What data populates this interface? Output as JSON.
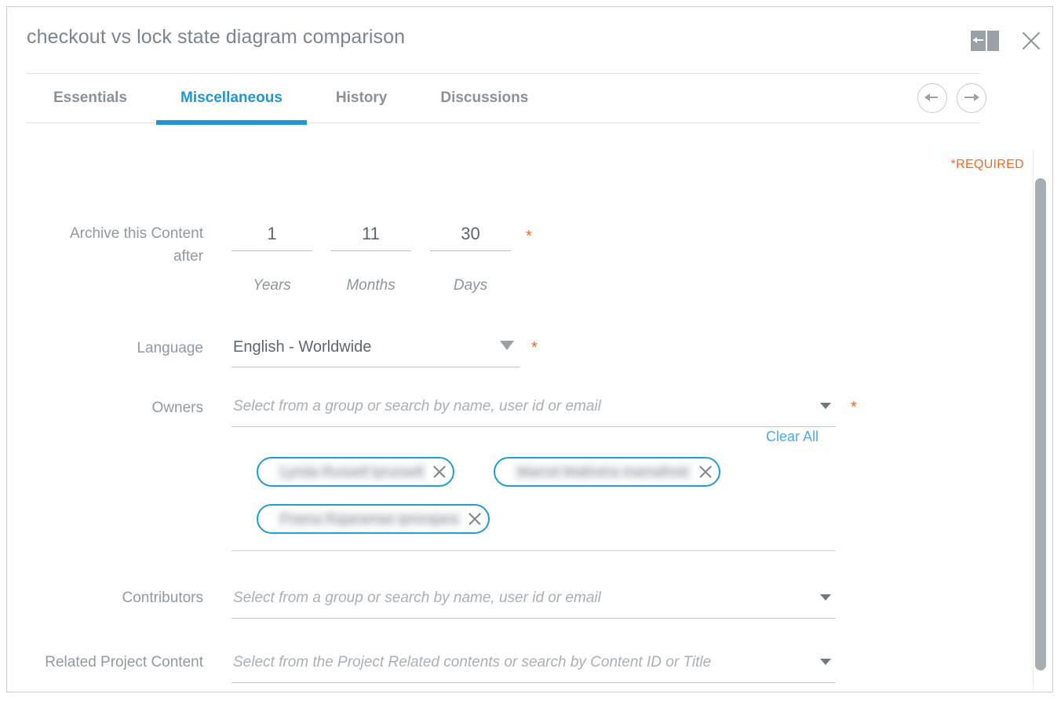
{
  "window": {
    "title": "checkout vs lock state diagram comparison",
    "collapse_icon": "collapse-panel-icon",
    "close_icon": "close-icon"
  },
  "tabs": [
    {
      "label": "Essentials",
      "active": false
    },
    {
      "label": "Miscellaneous",
      "active": true
    },
    {
      "label": "History",
      "active": false
    },
    {
      "label": "Discussions",
      "active": false
    }
  ],
  "nav": {
    "back_icon": "arrow-left-icon",
    "forward_icon": "arrow-right-icon"
  },
  "form": {
    "required_note": "*REQUIRED",
    "required_marker": "*",
    "archive": {
      "label_line1": "Archive this Content",
      "label_line2": "after",
      "years": {
        "value": "1",
        "unit": "Years"
      },
      "months": {
        "value": "11",
        "unit": "Months"
      },
      "days": {
        "value": "30",
        "unit": "Days"
      }
    },
    "language": {
      "label": "Language",
      "value": "English - Worldwide"
    },
    "owners": {
      "label": "Owners",
      "placeholder": "Select from a group or search by name, user id or email",
      "clear_all": "Clear All",
      "chips": [
        {
          "name": "Lynda Russell lyrussell"
        },
        {
          "name": "Marcel Malhotra mamalhotr"
        },
        {
          "name": "Prama Rajaraman iprorajara"
        }
      ]
    },
    "contributors": {
      "label": "Contributors",
      "placeholder": "Select from a group or search by name, user id or email"
    },
    "related_project_content": {
      "label": "Related Project Content",
      "placeholder": "Select from the Project Related contents or search by Content ID or Title"
    }
  },
  "colors": {
    "accent_blue": "#2196d3",
    "link_blue": "#4ca8f0",
    "required_orange": "#f26722",
    "label_gray": "#909a9f"
  }
}
